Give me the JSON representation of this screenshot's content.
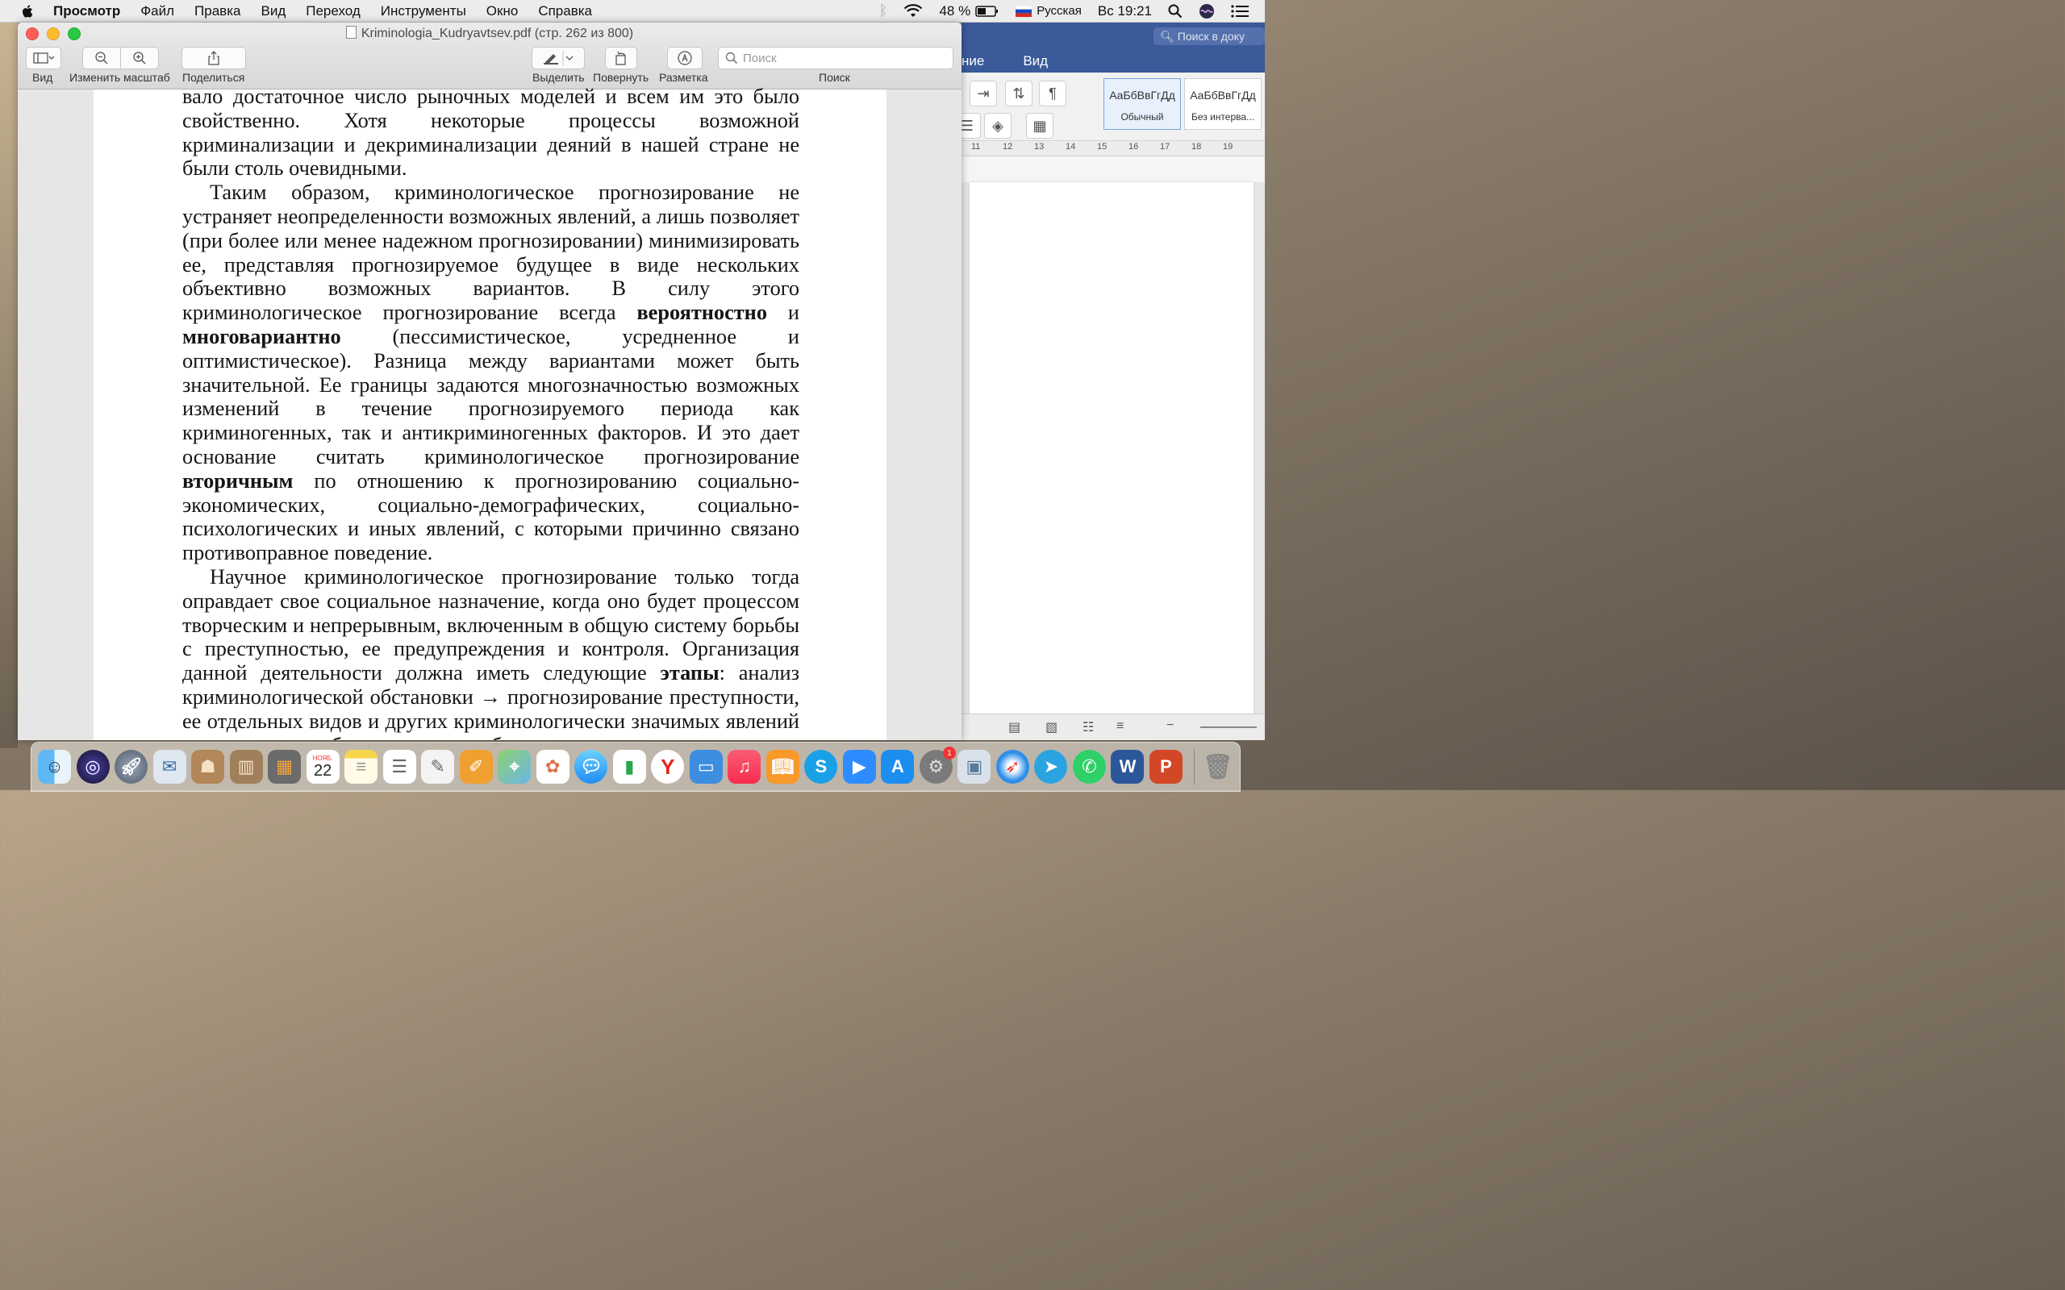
{
  "menubar": {
    "app": "Просмотр",
    "items": [
      "Файл",
      "Правка",
      "Вид",
      "Переход",
      "Инструменты",
      "Окно",
      "Справка"
    ],
    "battery": "48 %",
    "input_source": "Русская",
    "clock": "Вс 19:21"
  },
  "preview": {
    "title": "Kriminologia_Kudryavtsev.pdf (стр. 262 из 800)",
    "toolbar": {
      "view": "Вид",
      "zoom": "Изменить масштаб",
      "share": "Поделиться",
      "highlight": "Выделить",
      "rotate": "Повернуть",
      "markup": "Разметка",
      "search_placeholder": "Поиск",
      "search_label": "Поиск"
    },
    "document": {
      "p1": "вало достаточное число рыночных моделей и всем им это было свойственно. Хотя некоторые процессы возможной криминализации и декриминализации деяний в нашей стране не были столь очевидными.",
      "p2_a": "Таким образом, криминологическое прогнозирование не устраняет неопределенности возможных явлений, а лишь позволяет (при более или менее надежном прогнозировании) минимизировать ее, представляя прогнозируемое будущее в виде нескольких объективно возможных вариантов. В силу этого криминологическое прогнозирование всегда ",
      "p2_b1": "вероятностно",
      "p2_c": " и ",
      "p2_b2": "многовариантно",
      "p2_d": " (пессимистическое, усредненное и оптимистическое). Разница между вариантами может быть значительной. Ее границы задаются многозначностью возможных изменений в течение прогнозируемого периода как криминогенных, так и антикриминогенных факторов. И это дает основание считать криминологическое прогнозирование ",
      "p2_b3": "вторичным",
      "p2_e": " по отношению к прогнозированию социально-экономических, социально-демографических, социально-психологических и иных явлений, с которыми причинно связано противоправное поведение.",
      "p3_a": "Научное криминологическое прогнозирование только тогда оправдает свое социальное назначение, когда оно будет процессом творческим и непрерывным, включенным в общую систему борьбы с преступностью, ее предупреждения и контроля. Организация данной деятельности должна иметь следующие ",
      "p3_b": "этапы",
      "p3_c": ": анализ криминологической обстановки → прогнозирование преступности, ее отдельных видов и других криминологически значимых явлений в определенном будущем → разработка и"
    }
  },
  "word": {
    "search_placeholder": "Поиск в доку",
    "tab_partial": "ние",
    "tab_view": "Вид",
    "style1_sample": "АаБбВвГгДд",
    "style1_name": "Обычный",
    "style2_sample": "АаБбВвГгДд",
    "style2_name": "Без интерва...",
    "ruler": [
      "11",
      "12",
      "13",
      "14",
      "15",
      "16",
      "17",
      "18",
      "19"
    ]
  },
  "dock": {
    "calendar_month": "НОЯБ.",
    "calendar_day": "22",
    "badge_count": "1"
  },
  "colors": {
    "word_blue": "#3a5a9a",
    "traffic_red": "#fc5f57",
    "traffic_yellow": "#fdbc2e",
    "traffic_green": "#28c840"
  }
}
